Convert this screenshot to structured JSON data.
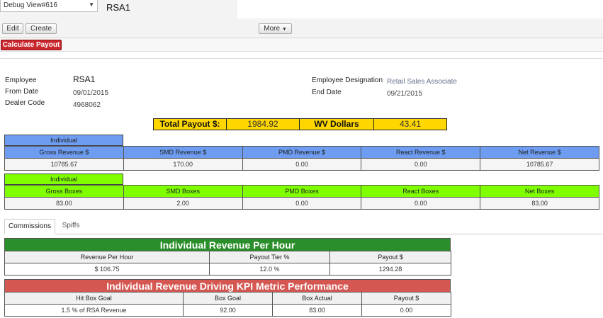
{
  "header": {
    "view_select": "Debug View#616",
    "record_title": "RSA1",
    "buttons": {
      "edit": "Edit",
      "create": "Create",
      "more": "More",
      "calculate": "Calculate Payout"
    }
  },
  "info": {
    "employee_label": "Employee",
    "employee": "RSA1",
    "from_date_label": "From Date",
    "from_date": "09/01/2015",
    "dealer_code_label": "Dealer Code",
    "dealer_code": "4968062",
    "designation_label": "Employee Designation",
    "designation": "Retail Sales Associate",
    "end_date_label": "End Date",
    "end_date": "09/21/2015"
  },
  "totals": {
    "total_payout_label": "Total Payout $:",
    "total_payout": "1984.92",
    "wv_label": "WV Dollars",
    "wv_dollars": "43.41"
  },
  "revenue": {
    "tag": "Individual",
    "headers": [
      "Gross Revenue $",
      "SMD Revenue $",
      "PMD Revenue $",
      "React Revenue $",
      "Net Revenue $"
    ],
    "values": [
      "10785.67",
      "170.00",
      "0.00",
      "0.00",
      "10785.67"
    ],
    "color": "#6d9cf0"
  },
  "boxes": {
    "tag": "Individual",
    "headers": [
      "Gross Boxes",
      "SMD Boxes",
      "PMD Boxes",
      "React Boxes",
      "Net Boxes"
    ],
    "values": [
      "83.00",
      "2.00",
      "0.00",
      "0.00",
      "83.00"
    ],
    "color": "#7fff00"
  },
  "tabs": [
    "Commissions",
    "Spiffs"
  ],
  "revenue_per_hour": {
    "title": "Individual Revenue Per Hour",
    "headers": [
      "Revenue Per Hour",
      "Payout Tier %",
      "Payout $"
    ],
    "values": [
      "$ 106.75",
      "12.0 %",
      "1294.28"
    ],
    "color": "#2a8f2a"
  },
  "kpi": {
    "title": "Individual Revenue Driving KPI Metric Performance",
    "headers": [
      "Hit Box Goal",
      "Box Goal",
      "Box Actual",
      "Payout $"
    ],
    "values": [
      "1.5 % of RSA Revenue",
      "92.00",
      "83.00",
      "0.00"
    ],
    "color": "#d55752"
  },
  "colors": {
    "accent_button": "#c9252c",
    "totals": "#ffd700"
  }
}
